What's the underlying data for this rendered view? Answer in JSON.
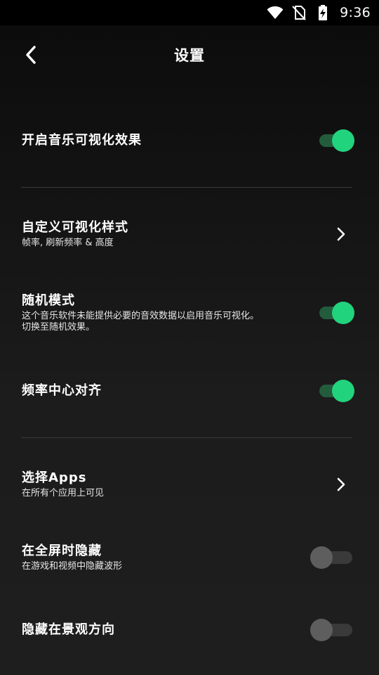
{
  "status_bar": {
    "time": "9:36"
  },
  "header": {
    "title": "设置"
  },
  "settings": {
    "visualizer": {
      "title": "开启音乐可视化效果",
      "enabled": true
    },
    "custom_style": {
      "title": "自定义可视化样式",
      "subtitle": "帧率, 刷新频率 & 高度"
    },
    "random_mode": {
      "title": "随机模式",
      "subtitle_line1": "这个音乐软件未能提供必要的音效数据以启用音乐可视化。",
      "subtitle_line2": "切换至随机效果。",
      "enabled": true
    },
    "center_align": {
      "title": "频率中心对齐",
      "enabled": true
    },
    "select_apps": {
      "title": "选择Apps",
      "subtitle": "在所有个应用上可见"
    },
    "hide_fullscreen": {
      "title": "在全屏时隐藏",
      "subtitle": "在游戏和视频中隐藏波形",
      "enabled": false
    },
    "hide_landscape": {
      "title": "隐藏在景观方向",
      "enabled": false
    }
  },
  "colors": {
    "accent": "#22d37d",
    "accent_track": "#235c3c",
    "off_thumb": "#5e5e5e",
    "off_track": "#3a3a3a"
  }
}
